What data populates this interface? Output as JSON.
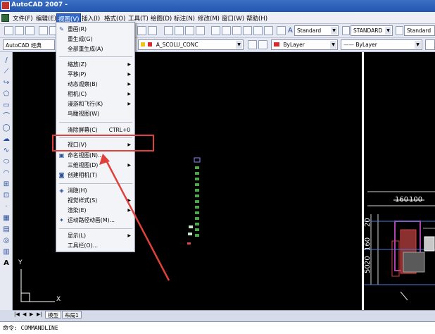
{
  "window": {
    "title": "AutoCAD 2007 - "
  },
  "menubar": {
    "items": [
      "文件(F)",
      "编辑(E)",
      "视图(V)",
      "插入(I)",
      "格式(O)",
      "工具(T)",
      "绘图(D)",
      "标注(N)",
      "修改(M)",
      "窗口(W)",
      "帮助(H)"
    ],
    "active": "视图(V)"
  },
  "toolbar1": {
    "text_style": "Standard",
    "dim_style": "STANDARD",
    "table_style": "Standard"
  },
  "toolbar2": {
    "workspace": "AutoCAD 经典",
    "layer": "A_SCOLU_CONC",
    "color": "ByLayer",
    "linetype": "ByLayer"
  },
  "view_menu": {
    "items": [
      {
        "label": "重画(R)",
        "icon": "pencil-icon"
      },
      {
        "label": "重生成(G)"
      },
      {
        "label": "全部重生成(A)"
      },
      {
        "label": "缩放(Z)",
        "submenu": true
      },
      {
        "label": "平移(P)",
        "submenu": true
      },
      {
        "label": "动态观察(B)",
        "submenu": true
      },
      {
        "label": "相机(C)",
        "submenu": true
      },
      {
        "label": "漫游和飞行(K)",
        "submenu": true
      },
      {
        "label": "鸟瞰视图(W)",
        "icon": "aerial-view-icon"
      },
      {
        "label": "清除屏幕(C)",
        "shortcut": "CTRL+0"
      },
      {
        "label": "视口(V)",
        "submenu": true
      },
      {
        "label": "命名视图(N)...",
        "icon": "named-view-icon"
      },
      {
        "label": "三维视图(D)",
        "submenu": true
      },
      {
        "label": "创建相机(T)",
        "icon": "camera-icon"
      },
      {
        "label": "消隐(H)",
        "icon": "hide-icon"
      },
      {
        "label": "视觉样式(S)",
        "submenu": true
      },
      {
        "label": "渲染(E)",
        "submenu": true
      },
      {
        "label": "运动路径动画(M)...",
        "icon": "motion-path-icon"
      },
      {
        "label": "显示(L)",
        "submenu": true
      },
      {
        "label": "工具栏(O)..."
      }
    ]
  },
  "tabs": [
    "模型",
    "布局1"
  ],
  "command": {
    "prompt": "命令:",
    "value": "COMMANDLINE"
  },
  "drawing": {
    "dims": [
      "160",
      "100",
      "50",
      "20",
      "160",
      "20"
    ],
    "ucs_x": "X",
    "ucs_y": "Y"
  },
  "colors": {
    "highlight": "#e0413c",
    "menu_active": "#3168c8",
    "canvas": "#000000"
  }
}
